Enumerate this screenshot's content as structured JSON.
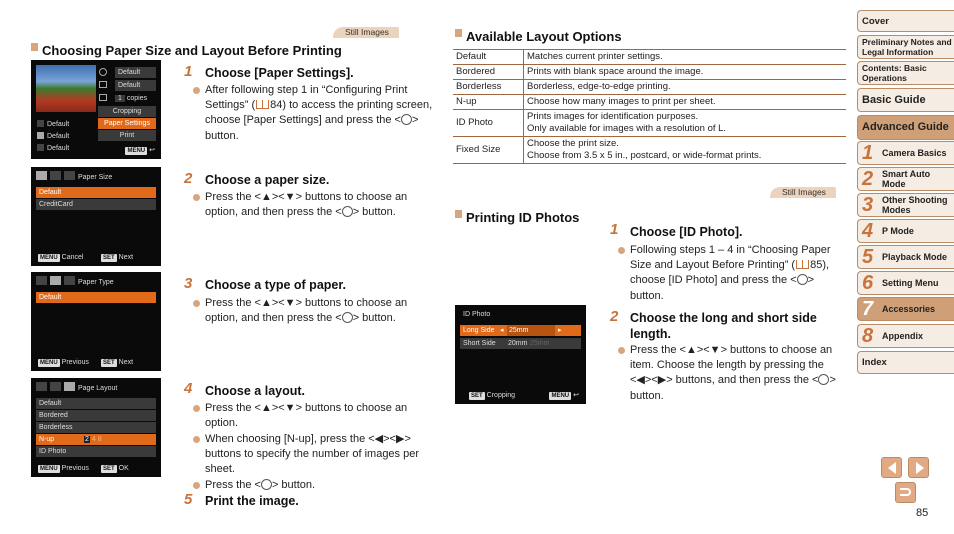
{
  "left": {
    "tag": "Still Images",
    "section_title": "Choosing Paper Size and Layout Before Printing",
    "steps": [
      {
        "num": "1",
        "title": "Choose [Paper Settings].",
        "bullets": [
          {
            "pre": "After following step 1 in “Configuring Print Settings” (",
            "ref": "84",
            "post": ") to access the printing screen, choose [Paper Settings] and press the <",
            "post2": "> button."
          }
        ]
      },
      {
        "num": "2",
        "title": "Choose a paper size.",
        "bullets": [
          {
            "pre": "Press the <▲><▼> buttons to choose an option, and then press the <",
            "post2": "> button."
          }
        ]
      },
      {
        "num": "3",
        "title": "Choose a type of paper.",
        "bullets": [
          {
            "pre": "Press the <▲><▼> buttons to choose an option, and then press the <",
            "post2": "> button."
          }
        ]
      },
      {
        "num": "4",
        "title": "Choose a layout.",
        "bullets": [
          {
            "text": "Press the <▲><▼> buttons to choose an option."
          },
          {
            "text": "When choosing [N-up], press the <◀><▶> buttons to specify the number of images per sheet."
          },
          {
            "pre": "Press the <",
            "post2": "> button."
          }
        ]
      },
      {
        "num": "5",
        "title": "Print the image."
      }
    ],
    "screen1": {
      "right_items": [
        "Default",
        "Default",
        "1",
        "copies",
        "Cropping",
        "Paper Settings",
        "Print"
      ],
      "left_items": [
        "Default",
        "Default",
        "Default"
      ],
      "menu_key": "MENU"
    },
    "screen2": {
      "title": "Paper Size",
      "items": [
        "Default",
        "CreditCard"
      ],
      "foot_left_key": "MENU",
      "foot_left": "Cancel",
      "foot_right_key": "SET",
      "foot_right": "Next"
    },
    "screen3": {
      "title": "Paper Type",
      "items": [
        "Default"
      ],
      "foot_left_key": "MENU",
      "foot_left": "Previous",
      "foot_right_key": "SET",
      "foot_right": "Next"
    },
    "screen4": {
      "title": "Page Layout",
      "items": [
        "Default",
        "Bordered",
        "Borderless",
        "N-up",
        "ID Photo"
      ],
      "nup_values": [
        "2",
        "4",
        "8"
      ],
      "foot_left_key": "MENU",
      "foot_left": "Previous",
      "foot_right_key": "SET",
      "foot_right": "OK"
    }
  },
  "middle": {
    "layout_title": "Available Layout Options",
    "layout_table": [
      {
        "option": "Default",
        "desc": [
          "Matches current printer settings."
        ]
      },
      {
        "option": "Bordered",
        "desc": [
          "Prints with blank space around the image."
        ]
      },
      {
        "option": "Borderless",
        "desc": [
          "Borderless, edge-to-edge printing."
        ]
      },
      {
        "option": "N-up",
        "desc": [
          "Choose how many images to print per sheet."
        ]
      },
      {
        "option": "ID Photo",
        "desc": [
          "Prints images for identification purposes.",
          "Only available for images with a resolution of L."
        ]
      },
      {
        "option": "Fixed Size",
        "desc": [
          "Choose the print size.",
          "Choose from 3.5 x 5 in., postcard, or wide-format prints."
        ]
      }
    ],
    "tag": "Still Images",
    "id_title": "Printing ID Photos",
    "steps": [
      {
        "num": "1",
        "title": "Choose [ID Photo].",
        "bullet": {
          "pre": "Following steps 1 – 4 in “Choosing Paper Size and Layout Before Printing” (",
          "ref": "85",
          "post": "), choose [ID Photo] and press the <",
          "post2": "> button."
        }
      },
      {
        "num": "2",
        "title": "Choose the long and short side length.",
        "bullet": {
          "pre": "Press the <▲><▼> buttons to choose an item. Choose the length by pressing the <◀><▶> buttons, and then press the <",
          "post2": "> button."
        }
      }
    ],
    "screen": {
      "title": "ID Photo",
      "long_label": "Long Side",
      "long_value": "25mm",
      "short_label": "Short Side",
      "short_value": "20mm",
      "short_ghost": "25mm",
      "foot_left_key": "SET",
      "foot_left": "Cropping",
      "foot_right_key": "MENU"
    }
  },
  "nav": {
    "items": [
      {
        "label": "Cover"
      },
      {
        "label": "Preliminary Notes and Legal Information"
      },
      {
        "label": "Contents: Basic Operations"
      },
      {
        "label": "Basic Guide"
      },
      {
        "label": "Advanced Guide"
      }
    ],
    "chapters": [
      {
        "num": "1",
        "label": "Camera Basics"
      },
      {
        "num": "2",
        "label": "Smart Auto Mode"
      },
      {
        "num": "3",
        "label": "Other Shooting Modes"
      },
      {
        "num": "4",
        "label": "P Mode"
      },
      {
        "num": "5",
        "label": "Playback Mode"
      },
      {
        "num": "6",
        "label": "Setting Menu"
      },
      {
        "num": "7",
        "label": "Accessories"
      },
      {
        "num": "8",
        "label": "Appendix"
      }
    ],
    "index": "Index",
    "active_chapter": "7"
  },
  "page_number": "85",
  "func_set": "FUNC SET"
}
